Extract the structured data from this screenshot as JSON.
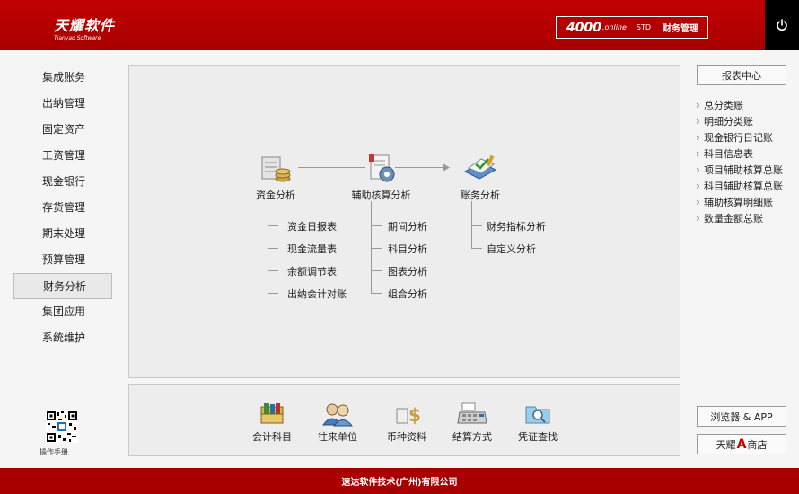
{
  "header": {
    "logo_cn": "天耀软件",
    "logo_en": "Tianyao Software",
    "version_num": "4000",
    "version_online": ".online",
    "version_std": "STD",
    "version_module": "财务管理"
  },
  "sidebar": {
    "items": [
      {
        "label": "集成账务"
      },
      {
        "label": "出纳管理"
      },
      {
        "label": "固定资产"
      },
      {
        "label": "工资管理"
      },
      {
        "label": "现金银行"
      },
      {
        "label": "存货管理"
      },
      {
        "label": "期末处理"
      },
      {
        "label": "预算管理"
      },
      {
        "label": "财务分析",
        "active": true
      },
      {
        "label": "集团应用"
      },
      {
        "label": "系统维护"
      }
    ],
    "manual_label": "操作手册"
  },
  "flow": {
    "nodes": [
      {
        "label": "资金分析",
        "icon": "fund-analysis-icon"
      },
      {
        "label": "辅助核算分析",
        "icon": "aux-analysis-icon"
      },
      {
        "label": "账务分析",
        "icon": "account-analysis-icon"
      }
    ],
    "fund_sub": [
      "资金日报表",
      "现金流量表",
      "余额调节表",
      "出纳会计对账"
    ],
    "aux_sub": [
      "期间分析",
      "科目分析",
      "图表分析",
      "组合分析"
    ],
    "account_sub": [
      "财务指标分析",
      "自定义分析"
    ]
  },
  "bottom_tools": [
    {
      "label": "会计科目",
      "icon": "accounting-subject-icon"
    },
    {
      "label": "往来单位",
      "icon": "contacts-icon"
    },
    {
      "label": "币种资料",
      "icon": "currency-icon"
    },
    {
      "label": "结算方式",
      "icon": "settlement-icon"
    },
    {
      "label": "凭证查找",
      "icon": "voucher-search-icon"
    }
  ],
  "right": {
    "report_center": "报表中心",
    "reports": [
      "总分类账",
      "明细分类账",
      "现金银行日记账",
      "科目信息表",
      "项目辅助核算总账",
      "科目辅助核算总账",
      "辅助核算明细账",
      "数量金额总账"
    ],
    "browser_app": "浏览器 & APP",
    "store_prefix": "天耀",
    "store_letter": "A",
    "store_suffix": "商店"
  },
  "footer": {
    "text": "速达软件技术(广州)有限公司"
  },
  "colors": {
    "brand_red": "#a80000",
    "panel_bg": "#ededed",
    "active_bg": "#e9e9e9"
  }
}
